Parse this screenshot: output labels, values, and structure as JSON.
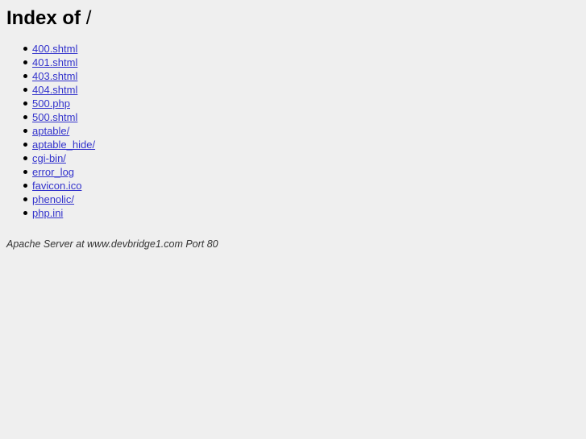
{
  "page": {
    "title_main": "Index of",
    "title_separator": "/",
    "background_color": "#efefef",
    "link_color": "#3333cc",
    "text_color": "#000000"
  },
  "listing": {
    "items": [
      {
        "label": "400.shtml"
      },
      {
        "label": "401.shtml"
      },
      {
        "label": "403.shtml"
      },
      {
        "label": "404.shtml"
      },
      {
        "label": "500.php"
      },
      {
        "label": "500.shtml"
      },
      {
        "label": "aptable/"
      },
      {
        "label": "aptable_hide/"
      },
      {
        "label": "cgi-bin/"
      },
      {
        "label": "error_log"
      },
      {
        "label": "favicon.ico"
      },
      {
        "label": "phenolic/"
      },
      {
        "label": "php.ini"
      }
    ]
  },
  "footer": {
    "signature": "Apache Server at www.devbridge1.com Port 80"
  }
}
